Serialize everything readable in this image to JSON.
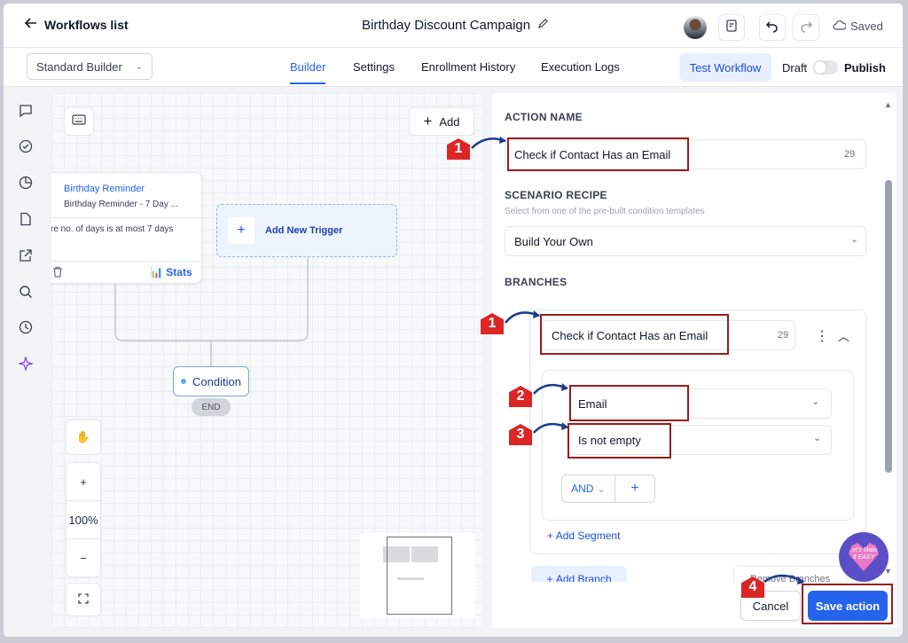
{
  "header": {
    "back_label": "Workflows list",
    "workflow_title": "Birthday Discount Campaign",
    "saved_label": "Saved"
  },
  "subbar": {
    "builder_select": "Standard Builder",
    "tabs": [
      {
        "label": "Builder",
        "active": true
      },
      {
        "label": "Settings",
        "active": false
      },
      {
        "label": "Enrollment History",
        "active": false
      },
      {
        "label": "Execution Logs",
        "active": false
      }
    ],
    "test_button": "Test Workflow",
    "draft_label": "Draft",
    "publish_label": "Publish"
  },
  "canvas": {
    "add_button": "Add",
    "trigger_card": {
      "title": "Birthday Reminder",
      "subtitle": "Birthday Reminder - 7 Day ...",
      "filter_text": "re no. of days is at most 7 days",
      "stats_label": "Stats"
    },
    "new_trigger_label": "Add New Trigger",
    "condition_label": "Condition",
    "end_label": "END",
    "zoom_plus": "+",
    "zoom_level": "100%",
    "zoom_minus": "−"
  },
  "panel": {
    "action_name_title": "ACTION NAME",
    "action_name_value": "Check if Contact Has an Email",
    "action_name_count": "29",
    "scenario_title": "SCENARIO RECIPE",
    "scenario_hint": "Select from one of the pre-built condition templates",
    "scenario_value": "Build Your Own",
    "branches_title": "BRANCHES",
    "branch_name_value": "Check if Contact Has an Email",
    "branch_name_count": "29",
    "field_select": "Email",
    "operator_select": "Is not empty",
    "and_label": "AND",
    "add_segment": "Add Segment",
    "add_branch": "Add Branch",
    "remove_branches": "Remove Branches",
    "cancel_label": "Cancel",
    "save_label": "Save action"
  },
  "annotations": {
    "step_badges": [
      "1",
      "1",
      "2",
      "3",
      "4"
    ],
    "highlight_color": "#9b1c1c",
    "badge_color": "#dc2626"
  },
  "watermark": {
    "text": "Let's Make It EASY"
  },
  "colors": {
    "accent": "#2563eb",
    "accent_light": "#e8efff"
  }
}
